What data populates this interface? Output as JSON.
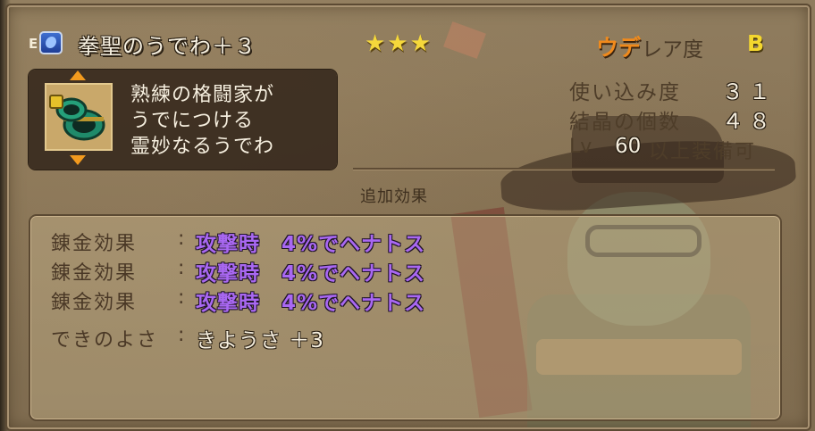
{
  "header": {
    "equipped_marker": "E",
    "item_type_icon": "bracelet-type-icon",
    "item_name": "拳聖のうでわ＋３",
    "stars": "★★★",
    "rarity_prefix": "ウデ",
    "rarity_label": "レア度",
    "rarity_grade": "B"
  },
  "description": {
    "item_icon": "green-bracelet-icon",
    "lines": [
      "熟練の格闘家が",
      "うでにつける",
      "霊妙なるうでわ"
    ]
  },
  "stats": {
    "usage_label": "使い込み度",
    "usage_value": "３１",
    "crystal_label": "結晶の個数",
    "crystal_value": "４８",
    "level_prefix": "Lv",
    "level_value": "60",
    "level_suffix": "以上装備可"
  },
  "bonus": {
    "title": "追加効果",
    "rows": [
      {
        "label": "錬金効果",
        "sep": ":",
        "value": "攻撃時　4%でヘナトス"
      },
      {
        "label": "錬金効果",
        "sep": ":",
        "value": "攻撃時　4%でヘナトス"
      },
      {
        "label": "錬金効果",
        "sep": ":",
        "value": "攻撃時　4%でヘナトス"
      },
      {
        "label": "できのよさ",
        "sep": ":",
        "value": "きようさ ＋3"
      }
    ]
  },
  "colors": {
    "effect_text": "#a968f2",
    "rarity_prefix": "#f08a1c",
    "stars": "#f5d83b"
  }
}
